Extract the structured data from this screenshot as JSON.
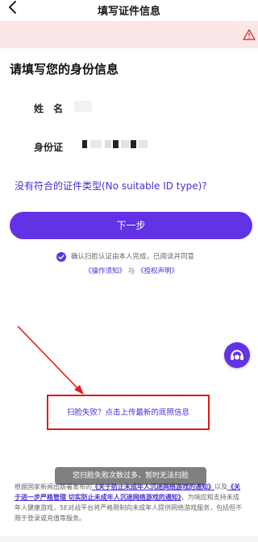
{
  "header": {
    "back_icon": "chevron-left-icon",
    "title": "填写证件信息"
  },
  "banner": {
    "icon": "warning-triangle-icon",
    "color": "#fbe7e7"
  },
  "form": {
    "section_title": "请填写您的身份信息",
    "name_label": "姓 名",
    "id_label": "身份证",
    "no_id_link": "没有符合的证件类型(No suitable ID type)?"
  },
  "actions": {
    "next_label": "下一步",
    "consent_text": "确认扫脸认证由本人完成，已阅读并同意",
    "consent_link_1": "《操作须知》",
    "consent_and": "与",
    "consent_link_2": "《授权声明》"
  },
  "upload": {
    "link_text": "扫脸失败？点击上传最新的底照信息"
  },
  "toast": {
    "text": "您扫脸失败次数过多，暂时无法扫脸"
  },
  "notice": {
    "p1": "根据国家新闻出版署发布的",
    "l1": "《关于防止未成年人沉迷网络游戏的通知》",
    "p2": "以及",
    "l2": "《关于进一步严格管理 切实防止未成年人沉迷网络游戏的通知》",
    "p3": "，为响应和支持未成年人健康游戏，5E对战平台将严格限制向未成年人提供网络游戏服务，包括但不限于登录或充值等服务。"
  },
  "colors": {
    "primary": "#6133e5",
    "link": "#4a2fd1",
    "annotation_red": "#e31919"
  }
}
